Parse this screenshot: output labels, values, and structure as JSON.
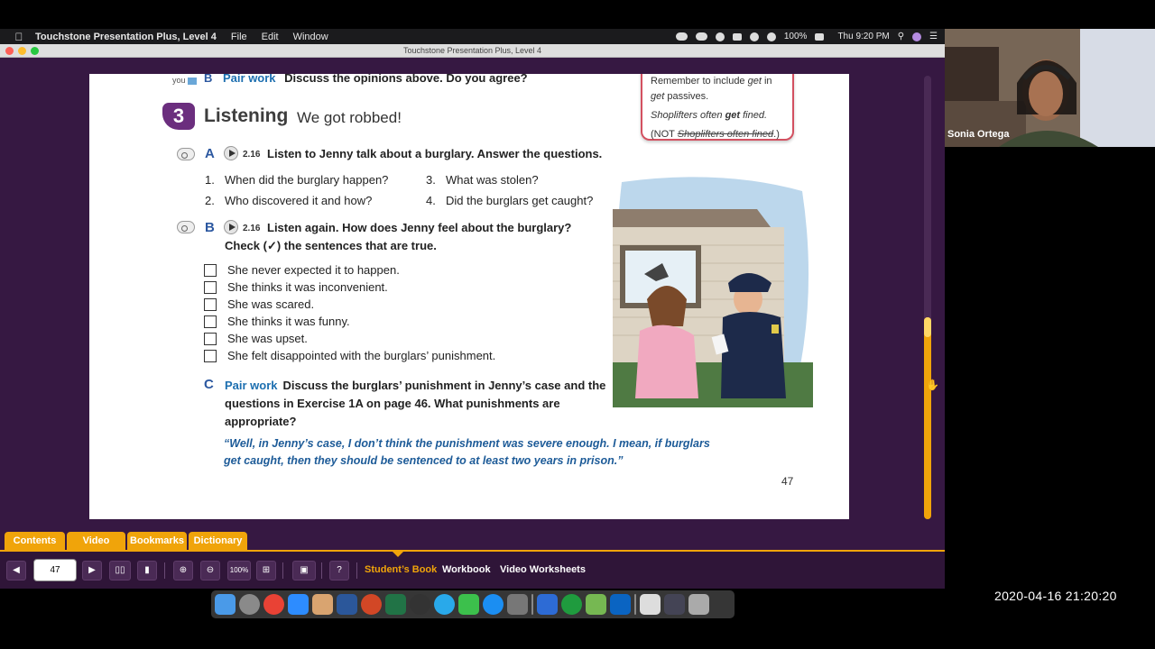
{
  "menubar": {
    "app": "Touchstone Presentation Plus, Level 4",
    "menus": [
      "File",
      "Edit",
      "Window"
    ],
    "battery": "100%",
    "clock": "Thu 9:20 PM"
  },
  "window": {
    "title": "Touchstone Presentation Plus, Level 4"
  },
  "page": {
    "top_line": {
      "letter": "B",
      "label": "Pair work",
      "text": "Discuss the opinions above. Do you agree?",
      "you": "you"
    },
    "section": {
      "number": "3",
      "title": "Listening",
      "subtitle": "We got robbed!"
    },
    "note": {
      "line1": "Remember to include",
      "line1_em": "get",
      "line1_tail": "in",
      "line2_em": "get",
      "line2_tail": "passives.",
      "line3_pre": "Shoplifters often",
      "line3_em": "get",
      "line3_tail": "fined.",
      "line4_pre": "(NOT",
      "line4_strike": "Shoplifters often fined",
      "line4_tail": ".)"
    },
    "a": {
      "letter": "A",
      "track": "2.16",
      "instruction": "Listen to Jenny talk about a burglary. Answer the questions.",
      "questions": [
        {
          "n": "1.",
          "text": "When did the burglary happen?"
        },
        {
          "n": "2.",
          "text": "Who discovered it and how?"
        },
        {
          "n": "3.",
          "text": "What was stolen?"
        },
        {
          "n": "4.",
          "text": "Did the burglars get caught?"
        }
      ]
    },
    "b": {
      "letter": "B",
      "track": "2.16",
      "instruction1": "Listen again. How does Jenny feel about the burglary?",
      "instruction2": "Check (✓) the sentences that are true.",
      "items": [
        "She never expected it to happen.",
        "She thinks it was inconvenient.",
        "She was scared.",
        "She thinks it was funny.",
        "She was upset.",
        "She felt disappointed with the burglars’ punishment."
      ]
    },
    "c": {
      "letter": "C",
      "label": "Pair work",
      "text": "Discuss the burglars’ punishment in Jenny’s case and the questions in Exercise 1A on page 46. What punishments are appropriate?",
      "quote": "“Well, in Jenny’s case, I don’t think the punishment was severe enough. I mean, if burglars get caught, then they should be sentenced to at least two years in prison.”"
    },
    "page_number": "47"
  },
  "tabs": [
    "Contents",
    "Video",
    "Bookmarks",
    "Dictionary"
  ],
  "toolbar": {
    "page_input": "47",
    "zoom_level": "100%",
    "books": [
      "Student’s Book",
      "Workbook",
      "Video Worksheets"
    ],
    "active_book": "Student’s Book"
  },
  "video": {
    "name": "Sonia Ortega"
  },
  "timestamp": "2020-04-16  21:20:20",
  "colors": {
    "brand_purple": "#361842",
    "accent_orange": "#f0a40a",
    "heading_blue": "#2c58a0"
  }
}
